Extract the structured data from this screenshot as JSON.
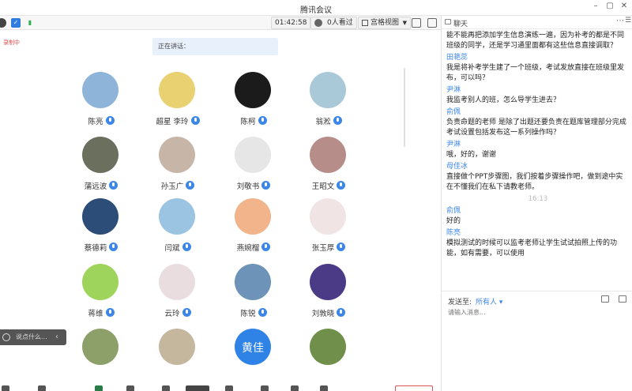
{
  "window": {
    "title": "腾讯会议",
    "controls": [
      "–",
      "▢",
      "✕"
    ]
  },
  "toolbar": {
    "timer": "01:42:58",
    "viewers": "0人看过",
    "view_mode": "宫格视图"
  },
  "main": {
    "recording_label": "录制中",
    "speaking_label": "正在讲话：",
    "say_placeholder": "说点什么..."
  },
  "participants": [
    {
      "name": "陈亮",
      "avatar_color": "#8fb4d9"
    },
    {
      "name": "超星 李玲",
      "avatar_color": "#e9d070"
    },
    {
      "name": "陈柯",
      "avatar_color": "#1b1b1b"
    },
    {
      "name": "翁淞",
      "avatar_color": "#a9c9d8"
    },
    {
      "name": "蒲远波",
      "avatar_color": "#6a6f5e"
    },
    {
      "name": "孙玉广",
      "avatar_color": "#c7b6a8"
    },
    {
      "name": "刘敬书",
      "avatar_color": "#e6e6e6"
    },
    {
      "name": "王昭文",
      "avatar_color": "#b78d8a"
    },
    {
      "name": "蔡德莉",
      "avatar_color": "#2c4d78"
    },
    {
      "name": "闫斌",
      "avatar_color": "#9bc4e2"
    },
    {
      "name": "燕婉榴",
      "avatar_color": "#f2b48a"
    },
    {
      "name": "张玉厚",
      "avatar_color": "#f1e4e4"
    },
    {
      "name": "蒋维",
      "avatar_color": "#9ed35c"
    },
    {
      "name": "云玲",
      "avatar_color": "#eadde0"
    },
    {
      "name": "陈锐",
      "avatar_color": "#6d94b8"
    },
    {
      "name": "刘敦晓",
      "avatar_color": "#4b3a86"
    },
    {
      "name": "",
      "avatar_color": "#8ea06a"
    },
    {
      "name": "",
      "avatar_color": "#c5b79e"
    },
    {
      "name": "",
      "avatar_color": "#2f82e6",
      "initial_text": "黄佳"
    },
    {
      "name": "",
      "avatar_color": "#6f8f4a"
    }
  ],
  "chat": {
    "title": "聊天",
    "messages": [
      {
        "sender": "",
        "text": "能不能再把添加学生信息演练一遍，因为补考的都是不同班级的同学，还是学习通里面都有这些信息直接调取？"
      },
      {
        "sender": "田艳蕊",
        "text": "我是将补考学生建了一个班级，考试发放直接在班级里发布，可以吗？"
      },
      {
        "sender": "尹淋",
        "text": "我监考别人的班，怎么导学生进去？"
      },
      {
        "sender": "俞佩",
        "text": "负责命题的老师 是除了出题还要负责在题库管理部分完成考试设置包括发布这一系列操作吗？"
      },
      {
        "sender": "尹淋",
        "text": "哦，好的，谢谢"
      },
      {
        "sender": "母佳冰",
        "text": "直接做个PPT步骤图，我们按着步骤操作吧，做到途中实在不懂我们在私下请教老师。"
      },
      {
        "timestamp": "16:13"
      },
      {
        "sender": "俞佩",
        "text": "好的"
      },
      {
        "sender": "陈亮",
        "text": "模拟测试的时候可以监考老师让学生试试拍照上传的功能，如有需要，可以使用"
      }
    ],
    "send_to_label": "发送至:",
    "send_to_value": "所有人",
    "input_placeholder": "请输入消息..."
  },
  "colors": {
    "accent": "#3b86e8",
    "sender": "#3b86e8"
  }
}
